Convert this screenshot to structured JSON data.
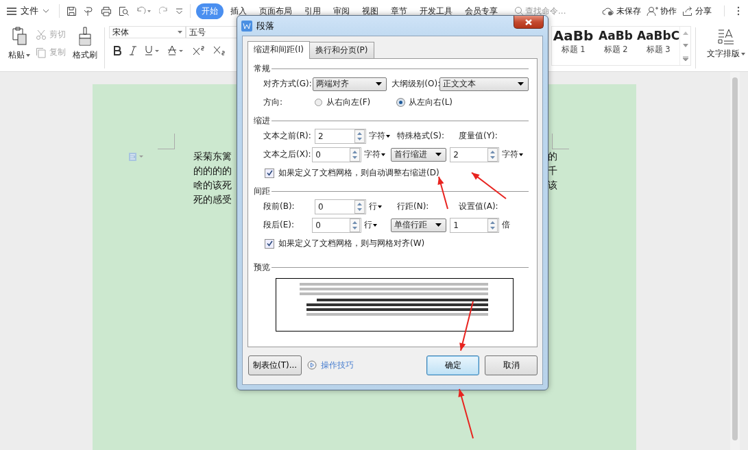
{
  "menubar": {
    "menu_label": "文件",
    "tabs": [
      {
        "label": "开始",
        "selected": true
      },
      {
        "label": "插入",
        "selected": false
      },
      {
        "label": "页面布局",
        "selected": false
      },
      {
        "label": "引用",
        "selected": false
      },
      {
        "label": "审阅",
        "selected": false
      },
      {
        "label": "视图",
        "selected": false
      },
      {
        "label": "章节",
        "selected": false
      },
      {
        "label": "开发工具",
        "selected": false
      },
      {
        "label": "会员专享",
        "selected": false
      }
    ],
    "search": {
      "placeholder": "查找命令..."
    },
    "actions": [
      {
        "kind": "cloud",
        "label": "未保存"
      },
      {
        "kind": "person",
        "label": "协作"
      },
      {
        "kind": "share",
        "label": "分享"
      }
    ]
  },
  "ribbon": {
    "paste": "粘贴",
    "small_tools": [
      {
        "kind": "cut",
        "label": "剪切",
        "disabled": true
      },
      {
        "kind": "copy",
        "label": "复制",
        "disabled": true
      }
    ],
    "format_painter": "格式刷",
    "font": "宋体",
    "size": "五号",
    "styles": [
      {
        "sample": "AaBb",
        "label": "标题 1"
      },
      {
        "sample": "AaBb",
        "label": "标题 2"
      },
      {
        "sample": "AaBbC",
        "label": "标题 3"
      }
    ],
    "text_layout": "文字排版"
  },
  "document": {
    "lines": [
      {
        "left": "采菊东篱",
        "right": "的"
      },
      {
        "left": "的的的的",
        "right": "千"
      },
      {
        "left": "啥的该死",
        "right": "该"
      },
      {
        "left": "死的感受"
      }
    ]
  },
  "dialog": {
    "title": "段落",
    "tabs": [
      {
        "label": "缩进和间距(I)",
        "selected": true
      },
      {
        "label": "换行和分页(P)",
        "selected": false
      }
    ],
    "general": {
      "title": "常规",
      "alignment": {
        "label": "对齐方式(G):",
        "value": "两端对齐"
      },
      "outline": {
        "label": "大纲级别(O):",
        "value": "正文文本"
      },
      "direction": {
        "label": "方向:",
        "options": [
          {
            "label": "从右向左(F)",
            "selected": false
          },
          {
            "label": "从左向右(L)",
            "selected": true
          }
        ]
      }
    },
    "indent": {
      "title": "缩进",
      "before": {
        "label": "文本之前(R):",
        "value": "2",
        "unit": {
          "text": "字符",
          "dropdown": true
        }
      },
      "after": {
        "label": "文本之后(X):",
        "value": "0",
        "unit": {
          "text": "字符",
          "dropdown": true
        }
      },
      "special": {
        "label": "特殊格式(S):",
        "value": "首行缩进"
      },
      "measure": {
        "label": "度量值(Y):",
        "value": "2",
        "unit": {
          "text": "字符",
          "dropdown": true
        }
      },
      "grid_option": {
        "label": "如果定义了文档网格，则自动调整右缩进(D)",
        "checked": true
      }
    },
    "spacing": {
      "title": "间距",
      "before": {
        "label": "段前(B):",
        "value": "0",
        "unit": {
          "text": "行",
          "dropdown": true
        }
      },
      "after": {
        "label": "段后(E):",
        "value": "0",
        "unit": {
          "text": "行",
          "dropdown": true
        }
      },
      "line": {
        "label": "行距(N):",
        "value": "单倍行距"
      },
      "amount": {
        "label": "设置值(A):",
        "value": "1",
        "unit": {
          "text": "倍",
          "dropdown": false
        }
      },
      "grid_option": {
        "label": "如果定义了文档网格，则与网格对齐(W)",
        "checked": true
      }
    },
    "preview": {
      "title": "预览"
    },
    "tab_stops_button": "制表位(T)...",
    "help_link": "操作技巧",
    "buttons": [
      {
        "label": "确定",
        "default": true
      },
      {
        "label": "取消",
        "default": false
      }
    ]
  }
}
